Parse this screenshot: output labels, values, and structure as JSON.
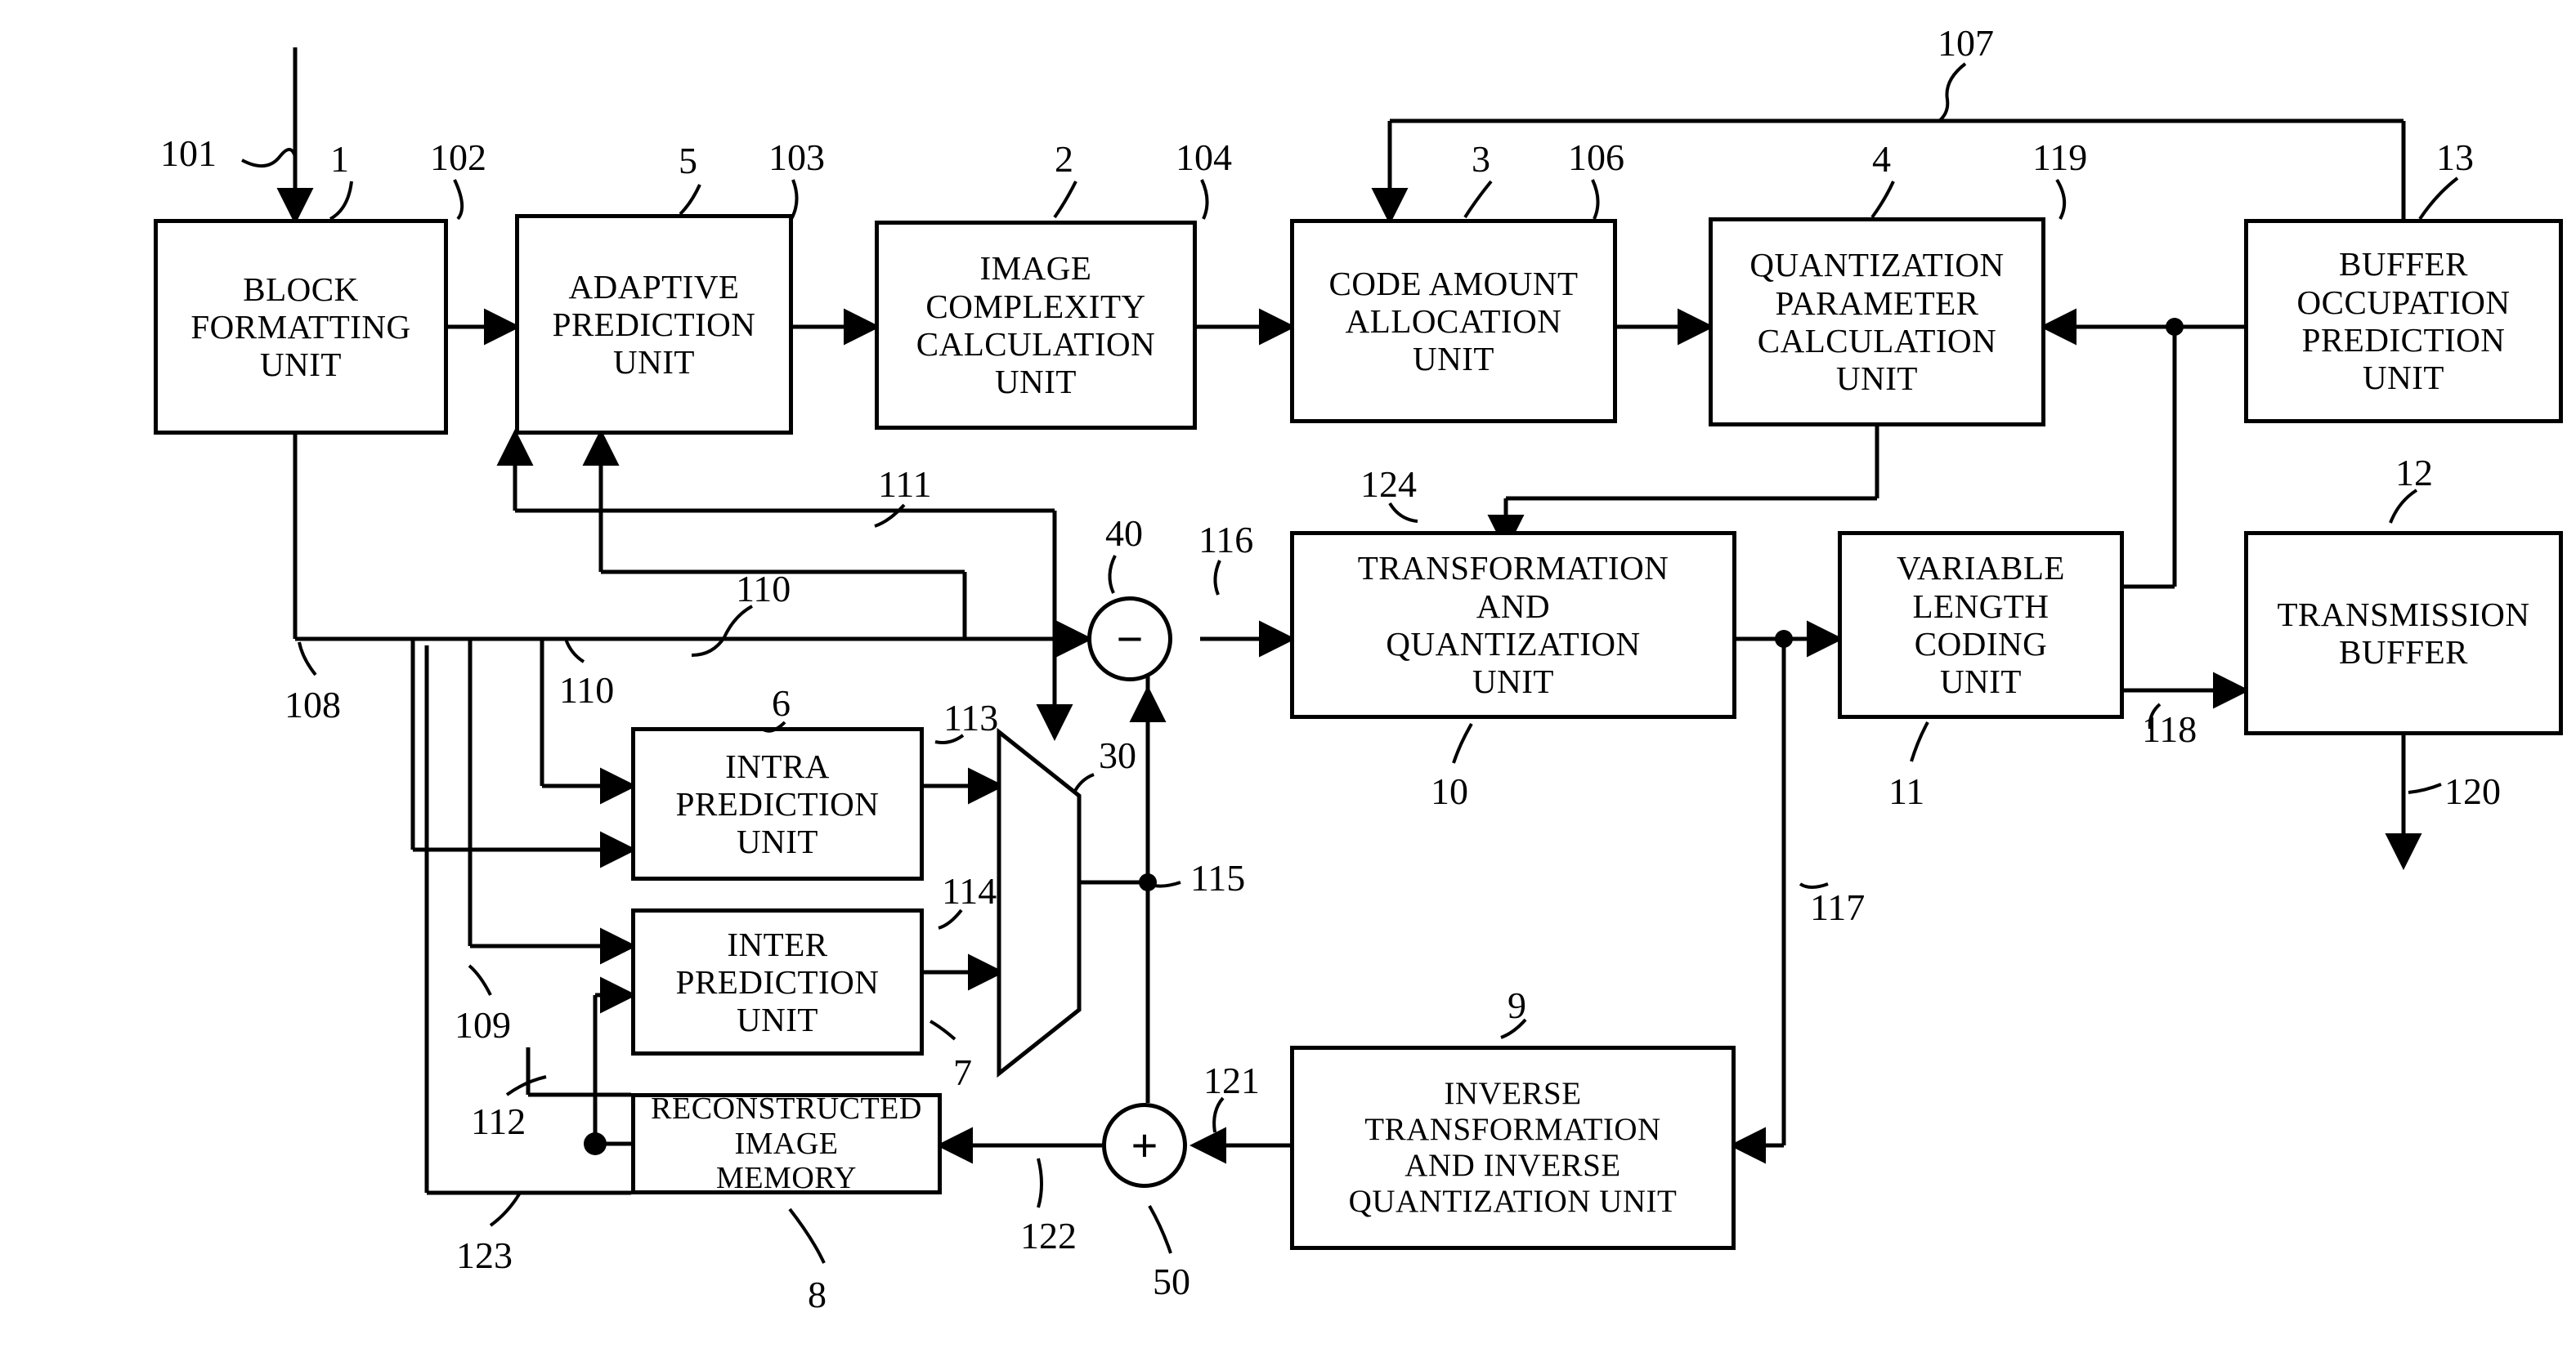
{
  "figure": {
    "type": "patent-block-diagram",
    "title": "Video encoder block diagram"
  },
  "blocks": [
    {
      "id": "block-formatting-unit",
      "label": "BLOCK\nFORMATTING\nUNIT",
      "ref": "1"
    },
    {
      "id": "adaptive-prediction-unit",
      "label": "ADAPTIVE\nPREDICTION\nUNIT",
      "ref": "5"
    },
    {
      "id": "image-complexity-calculation-unit",
      "label": "IMAGE\nCOMPLEXITY\nCALCULATION\nUNIT",
      "ref": "2"
    },
    {
      "id": "code-amount-allocation-unit",
      "label": "CODE AMOUNT\nALLOCATION\nUNIT",
      "ref": "3"
    },
    {
      "id": "quantization-parameter-calculation-unit",
      "label": "QUANTIZATION\nPARAMETER\nCALCULATION\nUNIT",
      "ref": "4"
    },
    {
      "id": "buffer-occupation-prediction-unit",
      "label": "BUFFER\nOCCUPATION\nPREDICTION\nUNIT",
      "ref": "13"
    },
    {
      "id": "transformation-and-quantization-unit",
      "label": "TRANSFORMATION\nAND\nQUANTIZATION\nUNIT",
      "ref": "10"
    },
    {
      "id": "variable-length-coding-unit",
      "label": "VARIABLE\nLENGTH\nCODING\nUNIT",
      "ref": "11"
    },
    {
      "id": "transmission-buffer",
      "label": "TRANSMISSION\nBUFFER",
      "ref": "12"
    },
    {
      "id": "intra-prediction-unit",
      "label": "INTRA\nPREDICTION\nUNIT",
      "ref": "6"
    },
    {
      "id": "inter-prediction-unit",
      "label": "INTER\nPREDICTION\nUNIT",
      "ref": "7"
    },
    {
      "id": "reconstructed-image-memory",
      "label": "RECONSTRUCTED\nIMAGE\nMEMORY",
      "ref": "8"
    },
    {
      "id": "inverse-transformation-and-inverse-quantization-unit",
      "label": "INVERSE\nTRANSFORMATION\nAND INVERSE\nQUANTIZATION UNIT",
      "ref": "9"
    }
  ],
  "operators": [
    {
      "id": "subtractor",
      "glyph": "−",
      "ref": "40"
    },
    {
      "id": "adder",
      "glyph": "+",
      "ref": "50"
    },
    {
      "id": "multiplexer",
      "ref": "30"
    }
  ],
  "labels": {
    "n1": "1",
    "n2": "2",
    "n3": "3",
    "n4": "4",
    "n5": "5",
    "n6": "6",
    "n7": "7",
    "n8": "8",
    "n9": "9",
    "n10": "10",
    "n11": "11",
    "n12": "12",
    "n13": "13",
    "n30": "30",
    "n40": "40",
    "n50": "50",
    "n101": "101",
    "n102": "102",
    "n103": "103",
    "n104": "104",
    "n106": "106",
    "n107": "107",
    "n108": "108",
    "n109": "109",
    "n110a": "110",
    "n110b": "110",
    "n111": "111",
    "n112": "112",
    "n113": "113",
    "n114": "114",
    "n115": "115",
    "n116": "116",
    "n117": "117",
    "n118": "118",
    "n119": "119",
    "n120": "120",
    "n121": "121",
    "n122": "122",
    "n123": "123",
    "n124": "124"
  },
  "colors": {
    "ink": "#000000",
    "paper": "#ffffff"
  }
}
